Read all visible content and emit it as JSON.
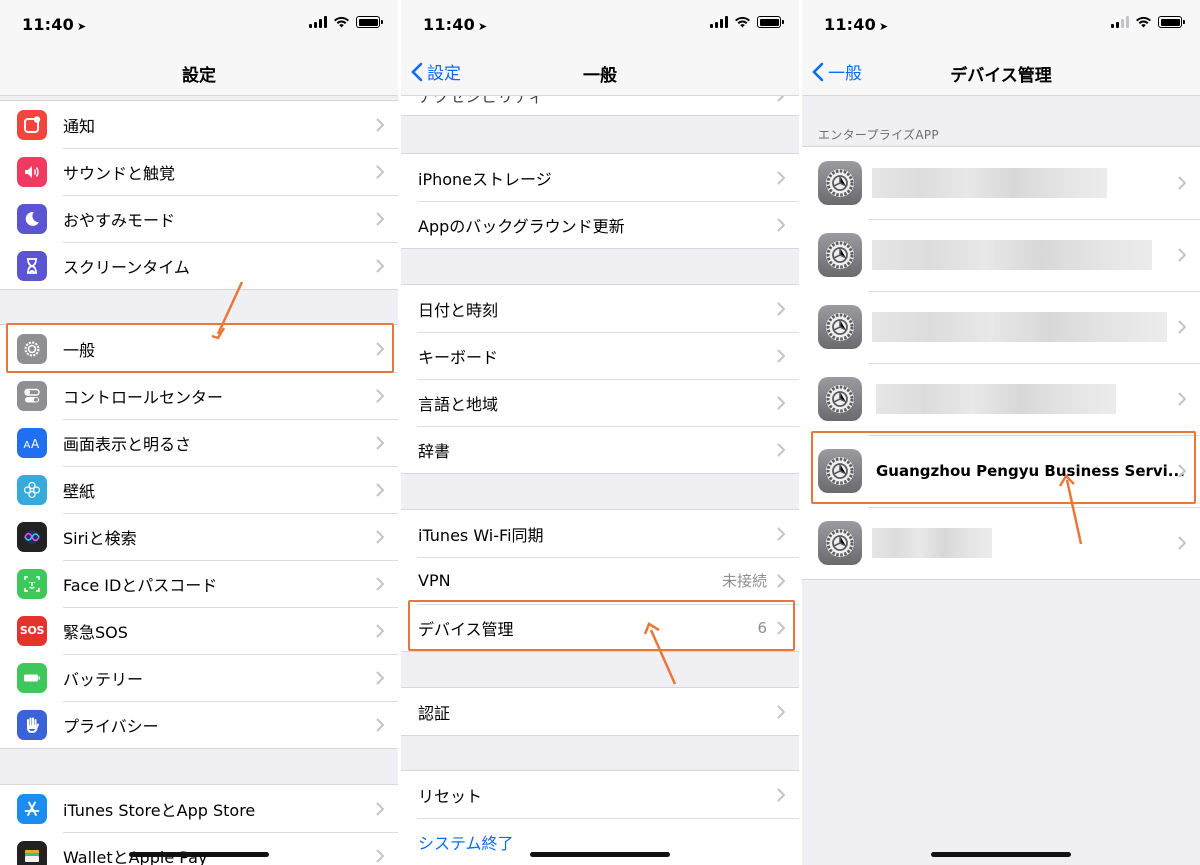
{
  "status": {
    "time": "11:40"
  },
  "panel1": {
    "title": "設定",
    "group_a": [
      {
        "label": "通知",
        "icon": "notification-icon",
        "color": "#f2453d"
      },
      {
        "label": "サウンドと触覚",
        "icon": "sound-icon",
        "color": "#f03a5f"
      },
      {
        "label": "おやすみモード",
        "icon": "moon-icon",
        "color": "#5b54d3"
      },
      {
        "label": "スクリーンタイム",
        "icon": "hourglass-icon",
        "color": "#5b54d3"
      }
    ],
    "group_b": [
      {
        "label": "一般",
        "icon": "gear-icon",
        "color": "#8e8e93"
      },
      {
        "label": "コントロールセンター",
        "icon": "toggle-icon",
        "color": "#8e8e93"
      },
      {
        "label": "画面表示と明るさ",
        "icon": "text-size-icon",
        "color": "#1f6ff0"
      },
      {
        "label": "壁紙",
        "icon": "flower-icon",
        "color": "#37aadc"
      },
      {
        "label": "Siriと検索",
        "icon": "siri-icon",
        "color": "#222222"
      },
      {
        "label": "Face IDとパスコード",
        "icon": "face-id-icon",
        "color": "#3ec75a"
      },
      {
        "label": "緊急SOS",
        "icon": "sos-icon",
        "color": "#e5322d",
        "icon_text": "SOS"
      },
      {
        "label": "バッテリー",
        "icon": "battery-icon",
        "color": "#3ec75a"
      },
      {
        "label": "プライバシー",
        "icon": "hand-icon",
        "color": "#3b63d9"
      }
    ],
    "group_c": [
      {
        "label": "iTunes StoreとApp Store",
        "icon": "app-store-icon",
        "color": "#1d8cf0"
      },
      {
        "label": "WalletとApple Pay",
        "icon": "wallet-icon",
        "color": "#222222"
      }
    ]
  },
  "panel2": {
    "back": "設定",
    "title": "一般",
    "cut_label": "アクセシビリティ",
    "group_a": [
      {
        "label": "iPhoneストレージ"
      },
      {
        "label": "Appのバックグラウンド更新"
      }
    ],
    "group_b": [
      {
        "label": "日付と時刻"
      },
      {
        "label": "キーボード"
      },
      {
        "label": "言語と地域"
      },
      {
        "label": "辞書"
      }
    ],
    "group_c": [
      {
        "label": "iTunes Wi-Fi同期"
      },
      {
        "label": "VPN",
        "detail": "未接続"
      },
      {
        "label": "デバイス管理",
        "detail": "6"
      }
    ],
    "group_d": [
      {
        "label": "認証"
      }
    ],
    "group_e": [
      {
        "label": "リセット"
      },
      {
        "label": "システム終了"
      }
    ]
  },
  "panel3": {
    "back": "一般",
    "title": "デバイス管理",
    "section": "エンタープライズAPP",
    "apps": [
      {
        "label": ""
      },
      {
        "label": ""
      },
      {
        "label": ""
      },
      {
        "label": ""
      },
      {
        "label": "Guangzhou Pengyu Business Servi..."
      },
      {
        "label": ""
      }
    ]
  },
  "colors": {
    "accent": "#0a6cf0",
    "highlight": "#e8773a"
  }
}
